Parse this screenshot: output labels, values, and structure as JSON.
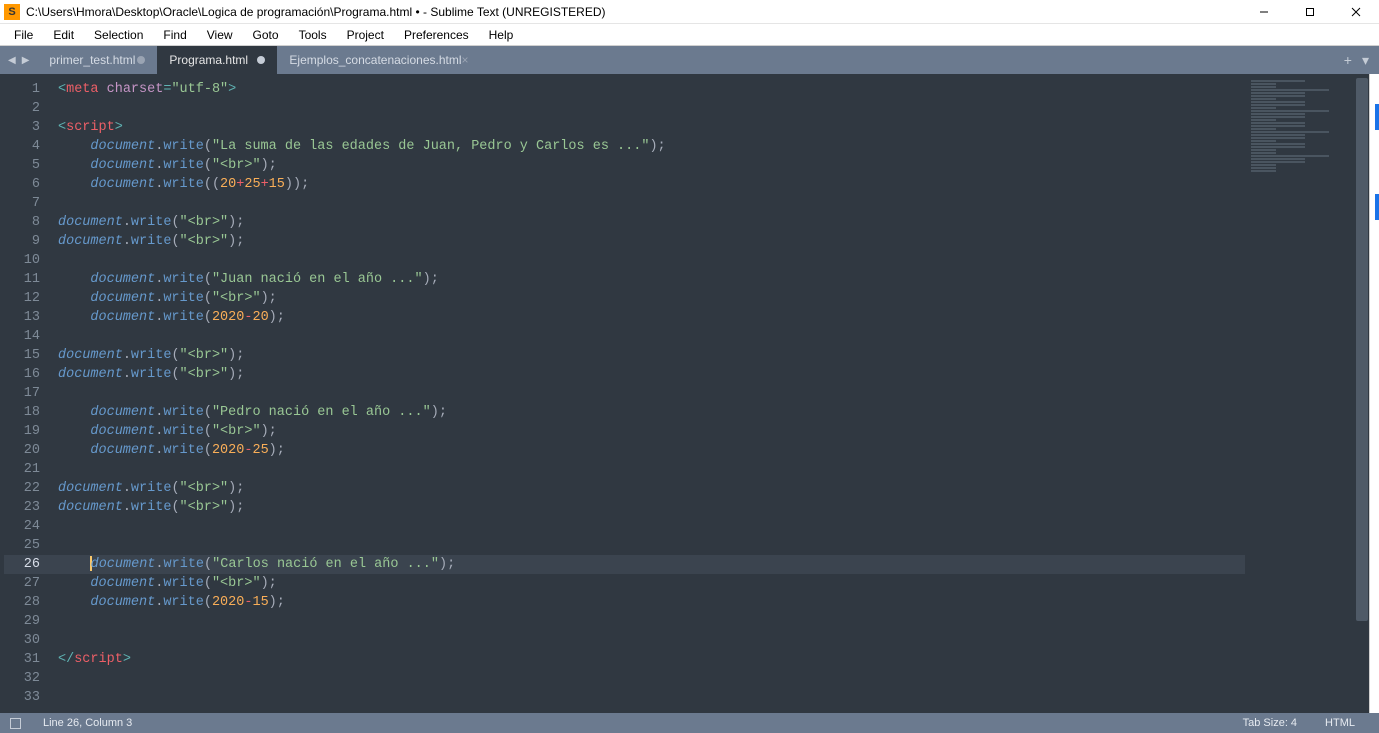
{
  "window": {
    "app_icon_letter": "S",
    "title": "C:\\Users\\Hmora\\Desktop\\Oracle\\Logica de programación\\Programa.html • - Sublime Text (UNREGISTERED)"
  },
  "menu": {
    "items": [
      "File",
      "Edit",
      "Selection",
      "Find",
      "View",
      "Goto",
      "Tools",
      "Project",
      "Preferences",
      "Help"
    ]
  },
  "tabs": {
    "nav_back": "◀",
    "nav_fwd": "▶",
    "items": [
      {
        "label": "primer_test.html",
        "active": false,
        "dirty": true
      },
      {
        "label": "Programa.html",
        "active": true,
        "dirty": true
      },
      {
        "label": "Ejemplos_concatenaciones.html",
        "active": false,
        "dirty": false
      }
    ],
    "add": "+",
    "menu": "▾"
  },
  "editor": {
    "current_line": 26,
    "total_lines": 33,
    "indent_unit": "    "
  },
  "code": {
    "l1": {
      "ang_o": "<",
      "tag": "meta",
      "sp": " ",
      "attr": "charset",
      "eq": "=",
      "str": "\"utf-8\"",
      "ang_c": ">"
    },
    "l3": {
      "ang_o": "<",
      "tag": "script",
      "ang_c": ">"
    },
    "l4": {
      "obj": "document",
      "dot": ".",
      "fn": "write",
      "po": "(",
      "str": "\"La suma de las edades de Juan, Pedro y Carlos es ...\"",
      "pc": ")",
      "sc": ";"
    },
    "l5": {
      "obj": "document",
      "dot": ".",
      "fn": "write",
      "po": "(",
      "str": "\"<br>\"",
      "pc": ")",
      "sc": ";"
    },
    "l6": {
      "obj": "document",
      "dot": ".",
      "fn": "write",
      "po": "((",
      "n1": "20",
      "op1": "+",
      "n2": "25",
      "op2": "+",
      "n3": "15",
      "pc": "))",
      "sc": ";"
    },
    "l8": {
      "obj": "document",
      "dot": ".",
      "fn": "write",
      "po": "(",
      "str": "\"<br>\"",
      "pc": ")",
      "sc": ";"
    },
    "l9": {
      "obj": "document",
      "dot": ".",
      "fn": "write",
      "po": "(",
      "str": "\"<br>\"",
      "pc": ")",
      "sc": ";"
    },
    "l11": {
      "obj": "document",
      "dot": ".",
      "fn": "write",
      "po": "(",
      "str": "\"Juan nació en el año ...\"",
      "pc": ")",
      "sc": ";"
    },
    "l12": {
      "obj": "document",
      "dot": ".",
      "fn": "write",
      "po": "(",
      "str": "\"<br>\"",
      "pc": ")",
      "sc": ";"
    },
    "l13": {
      "obj": "document",
      "dot": ".",
      "fn": "write",
      "po": "(",
      "n1": "2020",
      "op1": "-",
      "n2": "20",
      "pc": ")",
      "sc": ";"
    },
    "l15": {
      "obj": "document",
      "dot": ".",
      "fn": "write",
      "po": "(",
      "str": "\"<br>\"",
      "pc": ")",
      "sc": ";"
    },
    "l16": {
      "obj": "document",
      "dot": ".",
      "fn": "write",
      "po": "(",
      "str": "\"<br>\"",
      "pc": ")",
      "sc": ";"
    },
    "l18": {
      "obj": "document",
      "dot": ".",
      "fn": "write",
      "po": "(",
      "str": "\"Pedro nació en el año ...\"",
      "pc": ")",
      "sc": ";"
    },
    "l19": {
      "obj": "document",
      "dot": ".",
      "fn": "write",
      "po": "(",
      "str": "\"<br>\"",
      "pc": ")",
      "sc": ";"
    },
    "l20": {
      "obj": "document",
      "dot": ".",
      "fn": "write",
      "po": "(",
      "n1": "2020",
      "op1": "-",
      "n2": "25",
      "pc": ")",
      "sc": ";"
    },
    "l22": {
      "obj": "document",
      "dot": ".",
      "fn": "write",
      "po": "(",
      "str": "\"<br>\"",
      "pc": ")",
      "sc": ";"
    },
    "l23": {
      "obj": "document",
      "dot": ".",
      "fn": "write",
      "po": "(",
      "str": "\"<br>\"",
      "pc": ")",
      "sc": ";"
    },
    "l26": {
      "obj": "document",
      "dot": ".",
      "fn": "write",
      "po": "(",
      "str": "\"Carlos nació en el año ...\"",
      "pc": ")",
      "sc": ";"
    },
    "l27": {
      "obj": "document",
      "dot": ".",
      "fn": "write",
      "po": "(",
      "str": "\"<br>\"",
      "pc": ")",
      "sc": ";"
    },
    "l28": {
      "obj": "document",
      "dot": ".",
      "fn": "write",
      "po": "(",
      "n1": "2020",
      "op1": "-",
      "n2": "15",
      "pc": ")",
      "sc": ";"
    },
    "l31": {
      "ang_o": "</",
      "tag": "script",
      "ang_c": ">"
    }
  },
  "statusbar": {
    "cursor": "Line 26, Column 3",
    "tab_size": "Tab Size: 4",
    "syntax": "HTML"
  }
}
